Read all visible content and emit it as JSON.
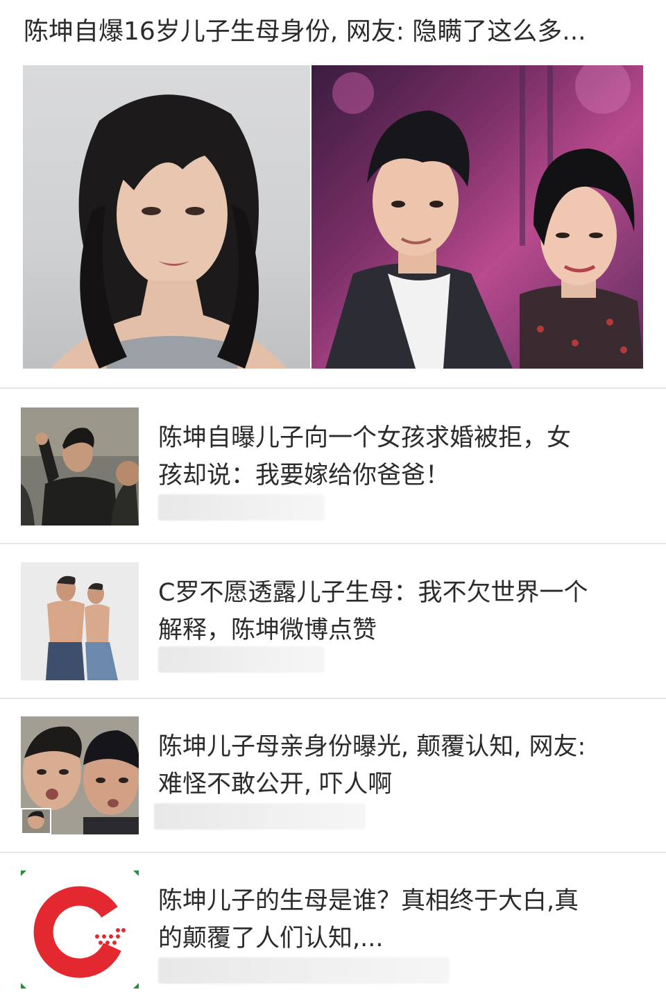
{
  "headline": {
    "title": "陈坤自爆16岁儿子生母身份, 网友: 隐瞒了这么多...",
    "image_icon": "photo-collage-icon"
  },
  "news_items": [
    {
      "title_line1": "陈坤自曝儿子向一个女孩求婚被拒，女",
      "title_line2": "孩却说：我要嫁给你爸爸！",
      "thumb_icon": "man-thumbnail-icon"
    },
    {
      "title_line1": "C罗不愿透露儿子生母：我不欠世界一个",
      "title_line2": "解释，陈坤微博点赞",
      "thumb_icon": "father-son-thumbnail-icon"
    },
    {
      "title_line1": "陈坤儿子母亲身份曝光, 颠覆认知, 网友:",
      "title_line2": "难怪不敢公开, 吓人啊",
      "thumb_icon": "selfie-thumbnail-icon"
    },
    {
      "title_line1": "陈坤儿子的生母是谁？真相终于大白,真",
      "title_line2": "的颠覆了人们认知,...",
      "thumb_icon": "red-c-logo-icon"
    }
  ],
  "colors": {
    "accent_red": "#e4282f",
    "divider": "#e6e6e6",
    "title_text": "#2b2b2b"
  }
}
